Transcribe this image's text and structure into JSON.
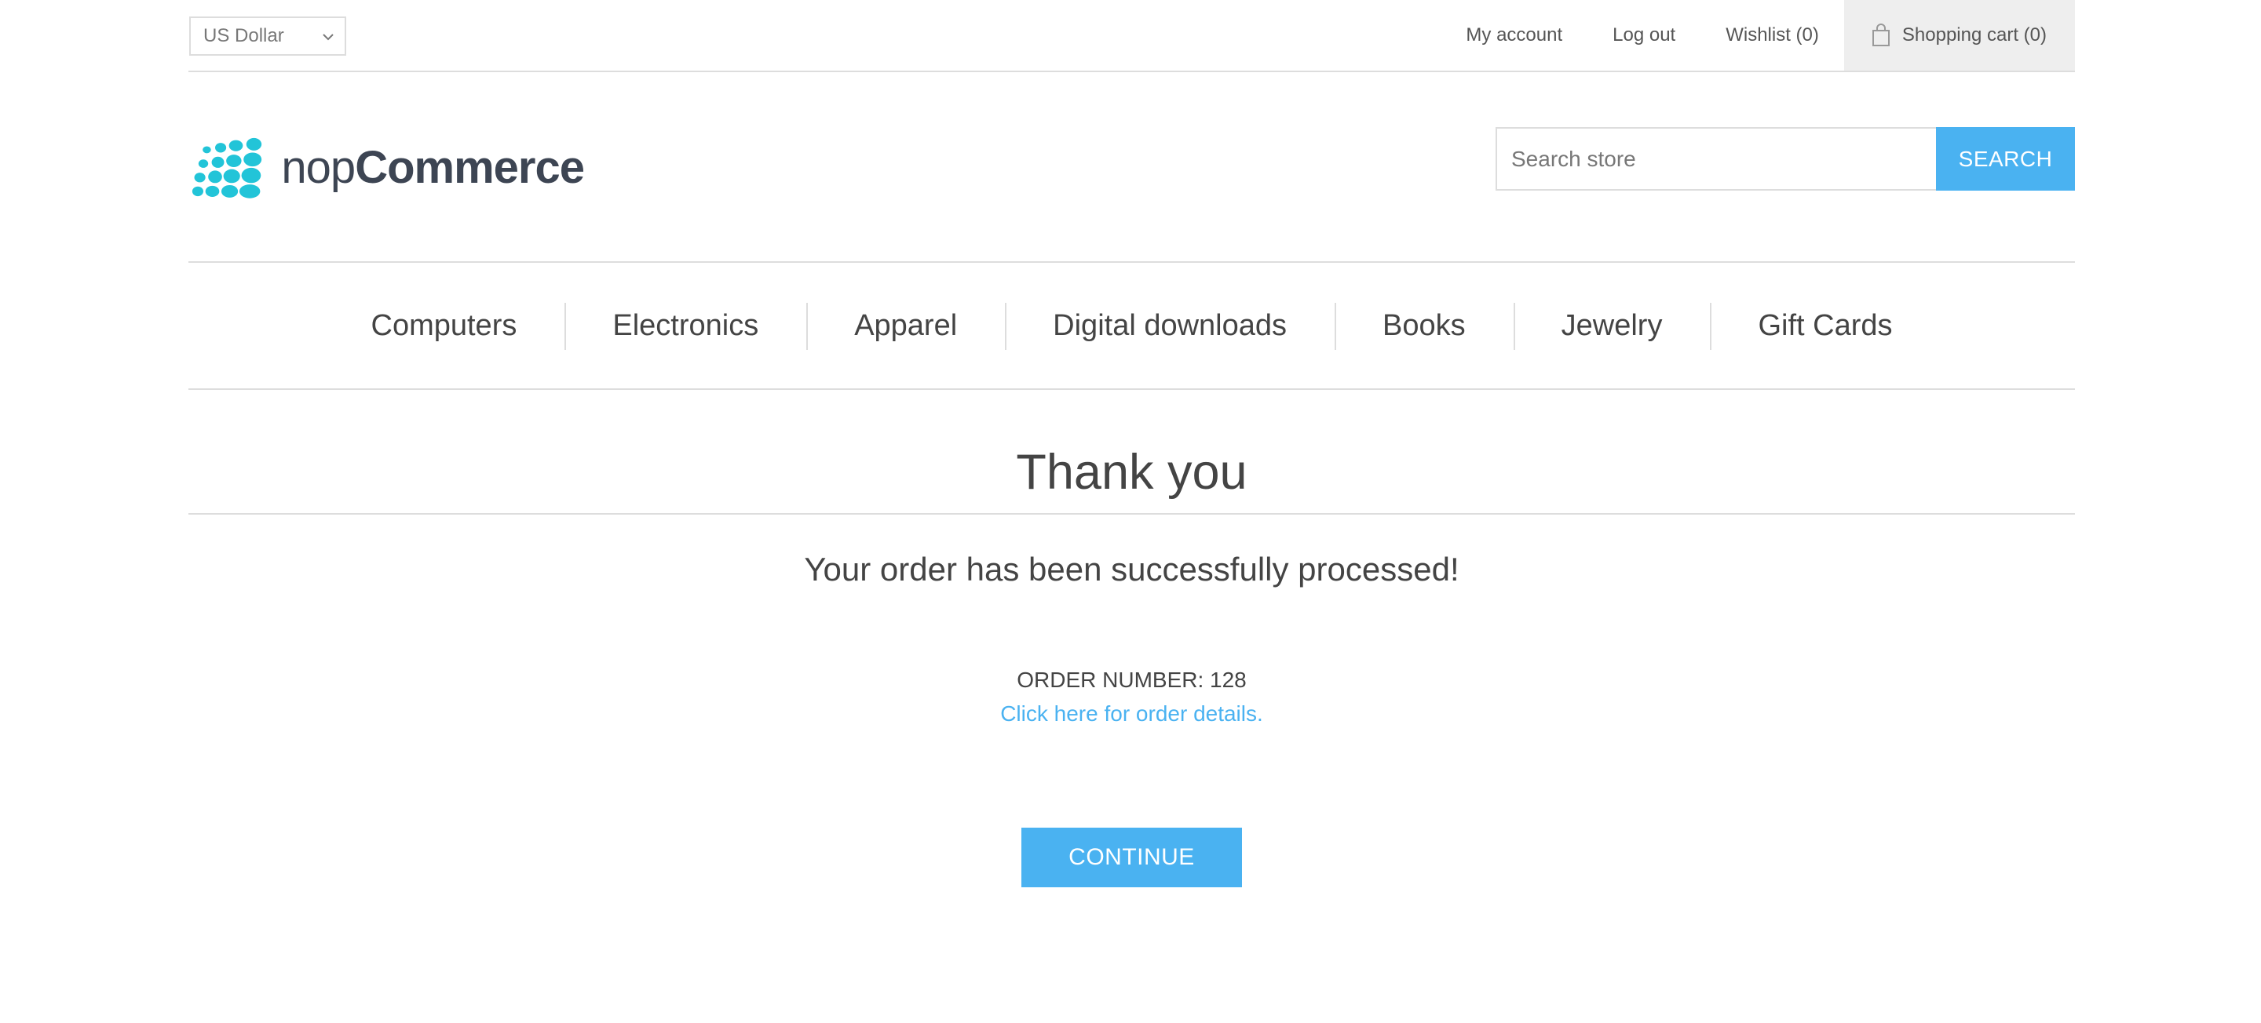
{
  "header": {
    "currency": {
      "selected": "US Dollar"
    },
    "links": {
      "my_account": "My account",
      "log_out": "Log out",
      "wishlist": "Wishlist (0)",
      "shopping_cart": "Shopping cart (0)"
    }
  },
  "logo": {
    "text_thin": "nop",
    "text_bold": "Commerce",
    "color": "#22c4d8"
  },
  "search": {
    "placeholder": "Search store",
    "button_label": "SEARCH"
  },
  "menu": {
    "items": [
      "Computers",
      "Electronics",
      "Apparel",
      "Digital downloads",
      "Books",
      "Jewelry",
      "Gift Cards"
    ]
  },
  "main": {
    "title": "Thank you",
    "message": "Your order has been successfully processed!",
    "order_number": "ORDER NUMBER: 128",
    "details_link": "Click here for order details.",
    "continue_label": "CONTINUE"
  },
  "colors": {
    "accent": "#4ab2f1",
    "border": "#dddddd",
    "text": "#444444"
  }
}
